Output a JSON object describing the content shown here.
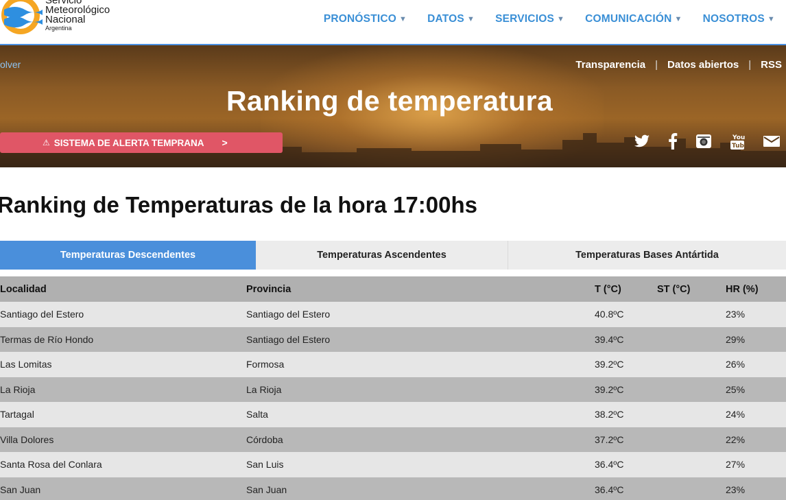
{
  "brand": {
    "line1": "Servicio",
    "line2": "Meteorológico",
    "line3": "Nacional",
    "line4": "Argentina"
  },
  "nav": [
    {
      "label": "PRONÓSTICO"
    },
    {
      "label": "DATOS"
    },
    {
      "label": "SERVICIOS"
    },
    {
      "label": "COMUNICACIÓN"
    },
    {
      "label": "NOSOTROS"
    }
  ],
  "hero": {
    "back_label": "olver",
    "links": [
      "Transparencia",
      "Datos abiertos",
      "RSS"
    ],
    "separator": "|",
    "title": "Ranking de temperatura",
    "alert_label": "SISTEMA DE ALERTA TEMPRANA",
    "social_icons": [
      "twitter-icon",
      "facebook-icon",
      "instagram-icon",
      "youtube-icon",
      "email-icon"
    ]
  },
  "section_title": "Ranking de Temperaturas de la hora 17:00hs",
  "tabs": [
    {
      "label": "Temperaturas Descendentes",
      "active": true
    },
    {
      "label": "Temperaturas Ascendentes",
      "active": false
    },
    {
      "label": "Temperaturas Bases Antártida",
      "active": false
    }
  ],
  "table": {
    "headers": [
      "Localidad",
      "Provincia",
      "T (°C)",
      "ST (°C)",
      "HR (%)"
    ],
    "rows": [
      [
        "Santiago del Estero",
        "Santiago del Estero",
        "40.8ºC",
        "",
        "23%"
      ],
      [
        "Termas de Río Hondo",
        "Santiago del Estero",
        "39.4ºC",
        "",
        "29%"
      ],
      [
        "Las Lomitas",
        "Formosa",
        "39.2ºC",
        "",
        "26%"
      ],
      [
        "La Rioja",
        "La Rioja",
        "39.2ºC",
        "",
        "25%"
      ],
      [
        "Tartagal",
        "Salta",
        "38.2ºC",
        "",
        "24%"
      ],
      [
        "Villa Dolores",
        "Córdoba",
        "37.2ºC",
        "",
        "22%"
      ],
      [
        "Santa Rosa del Conlara",
        "San Luis",
        "36.4ºC",
        "",
        "27%"
      ],
      [
        "San Juan",
        "San Juan",
        "36.4ºC",
        "",
        "23%"
      ]
    ]
  },
  "colors": {
    "nav_blue": "#3a8fd6",
    "active_tab": "#4a8fdb",
    "alert_red": "#e05666"
  }
}
